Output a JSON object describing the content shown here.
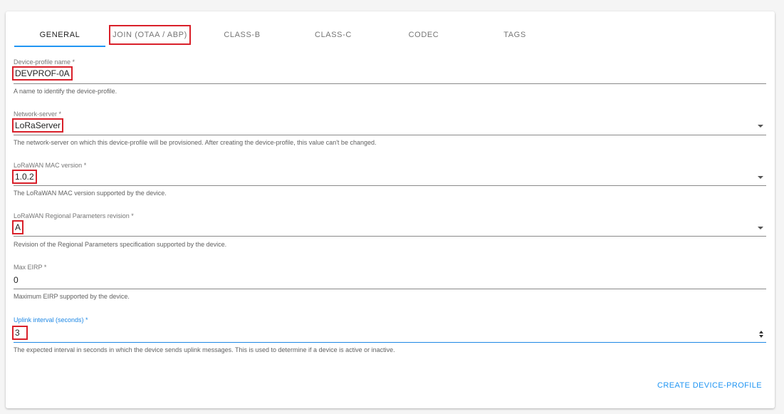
{
  "tabs": [
    {
      "label": "GENERAL",
      "active": true
    },
    {
      "label": "JOIN (OTAA / ABP)",
      "active": false
    },
    {
      "label": "CLASS-B",
      "active": false
    },
    {
      "label": "CLASS-C",
      "active": false
    },
    {
      "label": "CODEC",
      "active": false
    },
    {
      "label": "TAGS",
      "active": false
    }
  ],
  "fields": {
    "name": {
      "label": "Device-profile name *",
      "value": "DEVPROF-0A",
      "helper": "A name to identify the device-profile."
    },
    "network_server": {
      "label": "Network-server *",
      "value": "LoRaServer",
      "helper": "The network-server on which this device-profile will be provisioned. After creating the device-profile, this value can't be changed."
    },
    "mac_version": {
      "label": "LoRaWAN MAC version *",
      "value": "1.0.2",
      "helper": "The LoRaWAN MAC version supported by the device."
    },
    "regional_params": {
      "label": "LoRaWAN Regional Parameters revision *",
      "value": "A",
      "helper": "Revision of the Regional Parameters specification supported by the device."
    },
    "max_eirp": {
      "label": "Max EIRP *",
      "value": "0",
      "helper": "Maximum EIRP supported by the device."
    },
    "uplink_interval": {
      "label": "Uplink interval (seconds) *",
      "value": "3",
      "helper": "The expected interval in seconds in which the device sends uplink messages. This is used to determine if a device is active or inactive."
    }
  },
  "submit_label": "CREATE DEVICE-PROFILE",
  "colors": {
    "accent": "#2196f3",
    "highlight": "#d9202a"
  }
}
